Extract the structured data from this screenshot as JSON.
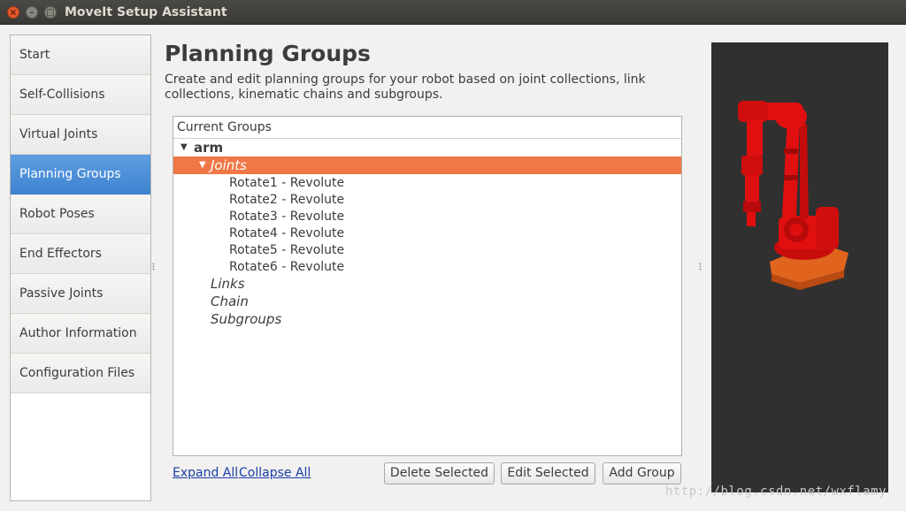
{
  "window": {
    "title": "MoveIt Setup Assistant",
    "close_glyph": "×",
    "min_glyph": "–",
    "max_glyph": "□"
  },
  "sidebar": {
    "items": [
      {
        "label": "Start"
      },
      {
        "label": "Self-Collisions"
      },
      {
        "label": "Virtual Joints"
      },
      {
        "label": "Planning Groups",
        "active": true
      },
      {
        "label": "Robot Poses"
      },
      {
        "label": "End Effectors"
      },
      {
        "label": "Passive Joints"
      },
      {
        "label": "Author Information"
      },
      {
        "label": "Configuration Files"
      }
    ],
    "active_color": "#4a8fd8"
  },
  "main": {
    "heading": "Planning Groups",
    "description": "Create and edit planning groups for your robot based on joint collections, link collections, kinematic chains and subgroups."
  },
  "tree": {
    "header": "Current Groups",
    "group": "arm",
    "expanded_glyph": "▼",
    "joints_label": "Joints",
    "joints": [
      "Rotate1 - Revolute",
      "Rotate2 - Revolute",
      "Rotate3 - Revolute",
      "Rotate4 - Revolute",
      "Rotate5 - Revolute",
      "Rotate6 - Revolute"
    ],
    "links_label": "Links",
    "chain_label": "Chain",
    "subgroups_label": "Subgroups",
    "selected_color": "#f07746"
  },
  "actions": {
    "expand_all": "Expand All",
    "collapse_all": "Collapse All",
    "delete_selected": "Delete Selected",
    "edit_selected": "Edit Selected",
    "add_group": "Add Group"
  },
  "viewport": {
    "robot_color": "#e01010",
    "base_color": "#e0641e",
    "background": "#303030"
  },
  "watermark": "http://blog.csdn.net/wxflamy"
}
